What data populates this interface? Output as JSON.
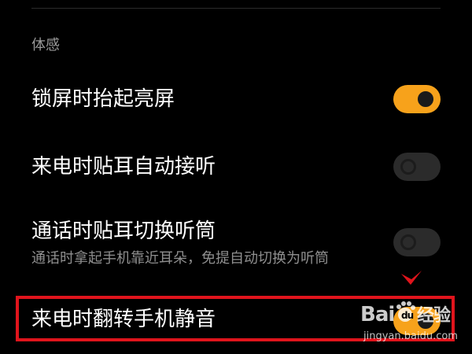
{
  "section": {
    "title": "体感"
  },
  "settings": [
    {
      "title": "锁屏时抬起亮屏",
      "subtitle": "",
      "state": "on"
    },
    {
      "title": "来电时贴耳自动接听",
      "subtitle": "",
      "state": "off"
    },
    {
      "title": "通话时贴耳切换听筒",
      "subtitle": "通话时拿起手机靠近耳朵，免提自动切换为听筒",
      "state": "off"
    },
    {
      "title": "来电时翻转手机静音",
      "subtitle": "",
      "state": "on"
    }
  ],
  "watermark": {
    "logo_text": "Bai du 经验",
    "url": "jingyan.baidu.com"
  },
  "colors": {
    "background": "#000000",
    "toggle_on": "#f7a21b",
    "toggle_off": "#2b2b2b",
    "highlight": "#e0141c",
    "section_title": "#9a9a9a",
    "subtitle": "#8f8f8f"
  }
}
